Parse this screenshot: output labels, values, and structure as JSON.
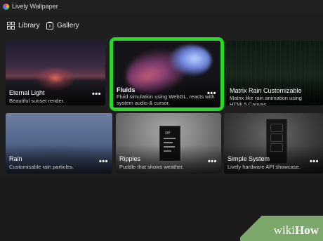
{
  "window": {
    "title": "Lively Wallpaper"
  },
  "nav": {
    "tabs": [
      {
        "label": "Library",
        "icon": "library-icon",
        "selected": true
      },
      {
        "label": "Gallery",
        "icon": "gallery-icon",
        "selected": false
      }
    ]
  },
  "wallpapers": [
    {
      "title": "Eternal Light",
      "description": "Beautiful sunset render."
    },
    {
      "title": "Fluids",
      "description": "Fluid simulation using WebGL, reacts with system audio & cursor.",
      "highlighted": true,
      "highlight_color": "#2bd62b"
    },
    {
      "title": "Matrix Rain Customizable",
      "description": "Matrix like rain animation using HTML5 Canvas."
    },
    {
      "title": "Rain",
      "description": "Customisable rain particles."
    },
    {
      "title": "Ripples",
      "description": "Puddle that shows weather.",
      "preview_text": "29°"
    },
    {
      "title": "Simple System",
      "description": "Lively hardware API showcase."
    }
  ],
  "more_label": "•••",
  "watermark": {
    "part1": "wiki",
    "part2": "How",
    "color": "#7da86b"
  }
}
